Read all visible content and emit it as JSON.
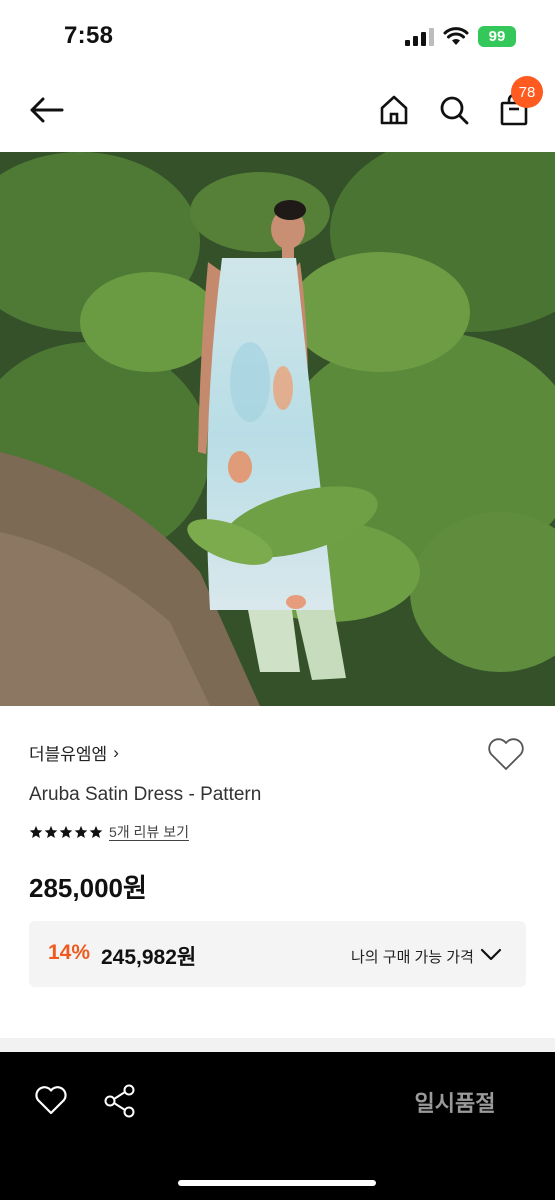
{
  "status_bar": {
    "time": "7:58",
    "battery": "99",
    "battery_color": "#34c759"
  },
  "nav": {
    "back_icon": "arrow-left-icon",
    "home_icon": "home-icon",
    "search_icon": "search-icon",
    "bag_icon": "shopping-bag-icon",
    "cart_count": "78",
    "badge_color": "#ff5a1f"
  },
  "product": {
    "brand": "더블유엠엠",
    "brand_chevron": "›",
    "name": "Aruba Satin Dress - Pattern",
    "rating_stars": 5,
    "review_link": "5개 리뷰 보기",
    "price": "285,000원"
  },
  "coupon": {
    "discount_rate": "14%",
    "discount_price": "245,982원",
    "label": "나의 구매 가능 가격",
    "accent_color": "#ef5a1f"
  },
  "bottom_bar": {
    "wish_icon": "heart-icon",
    "share_icon": "share-icon",
    "status_button": "일시품절"
  }
}
